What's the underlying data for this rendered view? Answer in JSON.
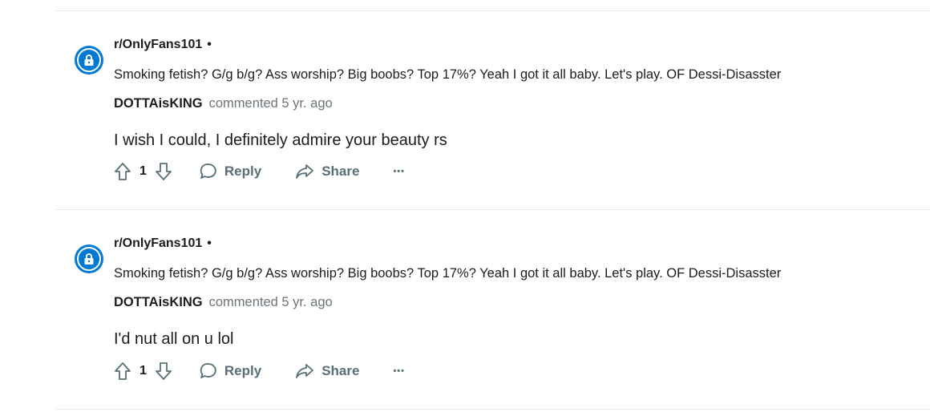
{
  "comments": [
    {
      "subreddit": "r/OnlyFans101",
      "separator": "•",
      "post_title": "Smoking fetish? G/g b/g? Ass worship? Big boobs? Top 17%? Yeah I got it all baby. Let's play. OF Dessi-Disasster",
      "author": "DOTTAisKING",
      "commented_text": "commented 5 yr. ago",
      "body": "I wish I could, I definitely admire your beauty rs",
      "vote_count": "1",
      "reply_label": "Reply",
      "share_label": "Share",
      "more_label": "•••"
    },
    {
      "subreddit": "r/OnlyFans101",
      "separator": "•",
      "post_title": "Smoking fetish? G/g b/g? Ass worship? Big boobs? Top 17%? Yeah I got it all baby. Let's play. OF Dessi-Disasster",
      "author": "DOTTAisKING",
      "commented_text": "commented 5 yr. ago",
      "body": "I'd nut all on u lol",
      "vote_count": "1",
      "reply_label": "Reply",
      "share_label": "Share",
      "more_label": "•••"
    }
  ],
  "colors": {
    "avatar_bg": "#0079d3",
    "muted_text": "#576f76",
    "divider": "#e5e7e9"
  }
}
